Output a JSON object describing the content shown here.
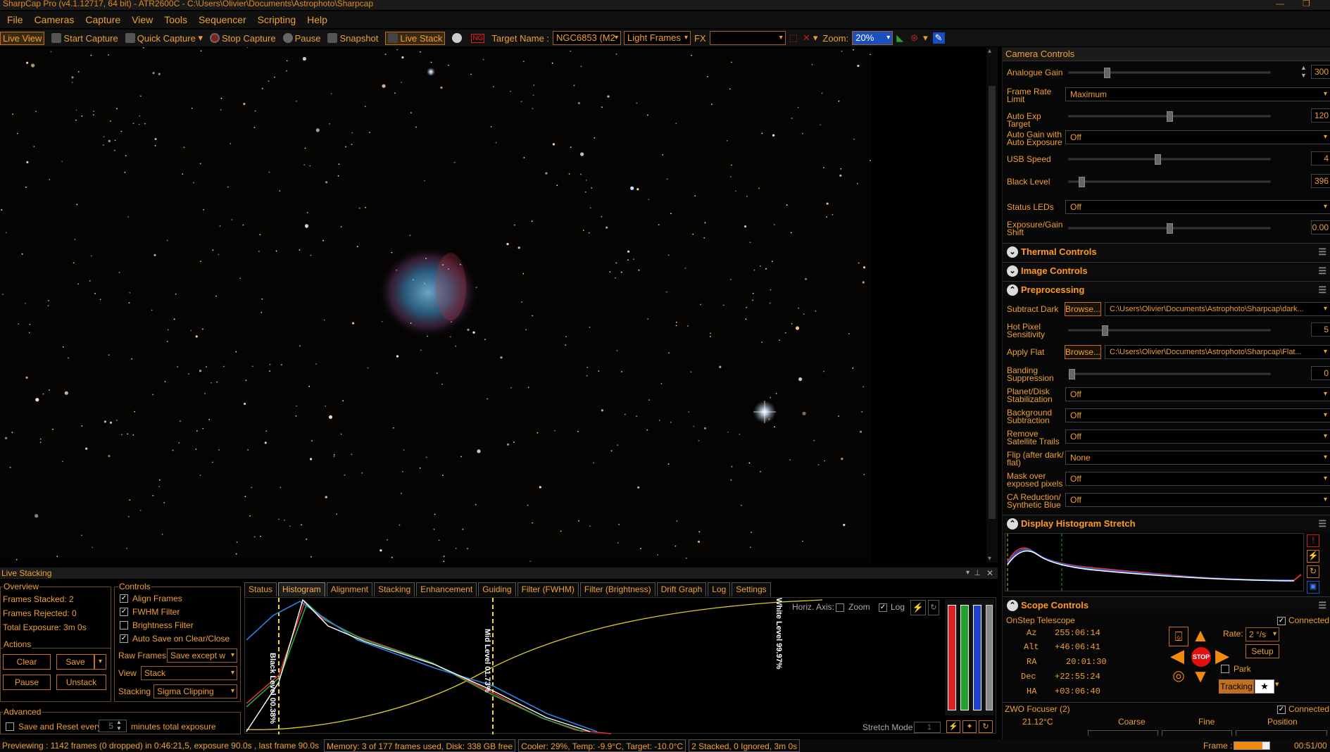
{
  "window": {
    "title": "SharpCap Pro (v4.1.12717, 64 bit) - ATR2600C - C:\\Users\\Olivier\\Documents\\Astrophoto\\Sharpcap"
  },
  "menu": [
    "File",
    "Cameras",
    "Capture",
    "View",
    "Tools",
    "Sequencer",
    "Scripting",
    "Help"
  ],
  "toolbar": {
    "live_view": "Live View",
    "start_capture": "Start Capture",
    "quick_capture": "Quick Capture",
    "stop_capture": "Stop Capture",
    "pause": "Pause",
    "snapshot": "Snapshot",
    "live_stack": "Live Stack",
    "target_label": "Target Name :",
    "target_value": "NGC6853 (M2",
    "frame_type": "Light Frames",
    "fx": "FX",
    "zoom_label": "Zoom:",
    "zoom_value": "20%"
  },
  "camera_controls": {
    "header": "Camera Controls",
    "analogue_gain": {
      "label": "Analogue Gain",
      "value": "300",
      "level": 0.18
    },
    "frame_rate": {
      "label": "Frame Rate Limit",
      "value": "Maximum"
    },
    "auto_exp_target": {
      "label": "Auto Exp Target",
      "value": "120",
      "level": 0.5
    },
    "auto_gain": {
      "label": "Auto Gain with Auto Exposure",
      "value": "Off"
    },
    "usb_speed": {
      "label": "USB Speed",
      "value": "4",
      "level": 0.44
    },
    "black_level": {
      "label": "Black Level",
      "value": "396",
      "level": 0.05
    },
    "status_leds": {
      "label": "Status LEDs",
      "value": "Off"
    },
    "exposure_gain_shift": {
      "label": "Exposure/Gain Shift",
      "value": "0.00",
      "level": 0.5
    }
  },
  "sections": {
    "thermal": "Thermal Controls",
    "image": "Image Controls",
    "preprocessing": "Preprocessing",
    "display_hist": "Display Histogram Stretch",
    "scope": "Scope Controls"
  },
  "preprocessing": {
    "subtract_dark": {
      "label": "Subtract Dark",
      "button": "Browse...",
      "path": "C:\\Users\\Olivier\\Documents\\Astrophoto\\Sharpcap\\dark..."
    },
    "hot_pixel": {
      "label": "Hot Pixel Sensitivity",
      "value": "5",
      "level": 0.17
    },
    "apply_flat": {
      "label": "Apply Flat",
      "button": "Browse...",
      "path": "C:\\Users\\Olivier\\Documents\\Astrophoto\\Sharpcap\\Flat..."
    },
    "banding": {
      "label": "Banding Suppression",
      "value": "0",
      "level": 0.0
    },
    "planet_stab": {
      "label": "Planet/Disk Stabilization",
      "value": "Off"
    },
    "background_sub": {
      "label": "Background Subtraction",
      "value": "Off"
    },
    "satellite": {
      "label": "Remove Satellite Trails",
      "value": "Off"
    },
    "flip": {
      "label": "Flip (after dark/ flat)",
      "value": "None"
    },
    "mask": {
      "label": "Mask over exposed pixels",
      "value": "Off"
    },
    "ca": {
      "label": "CA Reduction/ Synthetic Blue",
      "value": "Off"
    }
  },
  "scope": {
    "mount": "OnStep Telescope",
    "connected": "Connected",
    "az_label": "Az",
    "az": "255:06:14",
    "alt_label": "Alt",
    "alt": "+46:06:41",
    "ra_label": "RA",
    "ra": "20:01:30",
    "dec_label": "Dec",
    "dec": "+22:55:24",
    "ha_label": "HA",
    "ha": "+03:06:40",
    "rate_label": "Rate:",
    "rate": "2 °/s",
    "setup": "Setup",
    "park": "Park",
    "stop": "STOP",
    "tracking": "Tracking",
    "focuser": "ZWO Focuser (2)",
    "focuser_connected": "Connected",
    "temp": "21.12°C",
    "coarse": "Coarse",
    "fine": "Fine",
    "position": "Position"
  },
  "live_stacking": {
    "title": "Live Stacking",
    "overview": "Overview",
    "frames_stacked": "Frames Stacked:  2",
    "frames_rejected": "Frames Rejected: 0",
    "total_exposure": "Total Exposure:    3m 0s",
    "actions": "Actions",
    "clear": "Clear",
    "save": "Save",
    "pause": "Pause",
    "unstack": "Unstack",
    "controls": "Controls",
    "align_frames": "Align Frames",
    "fwhm_filter": "FWHM Filter",
    "brightness_filter": "Brightness Filter",
    "auto_save": "Auto Save on Clear/Close",
    "raw_frames_label": "Raw Frames",
    "raw_frames_value": "Save except w",
    "view_label": "View",
    "view_value": "Stack",
    "stacking_label": "Stacking",
    "stacking_value": "Sigma Clipping",
    "advanced": "Advanced",
    "save_reset": "Save and Reset every",
    "minutes_value": "5",
    "minutes_label": "minutes total exposure"
  },
  "tabs": [
    "Status",
    "Histogram",
    "Alignment",
    "Stacking",
    "Enhancement",
    "Guiding",
    "Filter (FWHM)",
    "Filter (Brightness)",
    "Drift Graph",
    "Log",
    "Settings"
  ],
  "histogram": {
    "horiz_axis": "Horiz. Axis:",
    "zoom": "Zoom",
    "log": "Log",
    "black_level": "Black Level 00.38%",
    "mid_level": "Mid Level 01.73%",
    "white_level": "White Level 99.97%",
    "stretch_mode": "Stretch Mode",
    "stretch_value": "1"
  },
  "status": {
    "preview": "Previewing : 1142 frames (0 dropped) in 0:46:21,5, exposure 90.0s , last frame 90.0s",
    "memory": "Memory: 3 of 177 frames used, Disk: 338 GB free",
    "cooler": "Cooler: 29%, Temp: -9.9°C, Target: -10.0°C",
    "stacked": "2 Stacked, 0 Ignored, 3m 0s",
    "frame_label": "Frame :",
    "frame_time": "00:51/00"
  },
  "colors": {
    "accent": "#f0a030",
    "bg": "#000000",
    "stop": "#e01010"
  }
}
